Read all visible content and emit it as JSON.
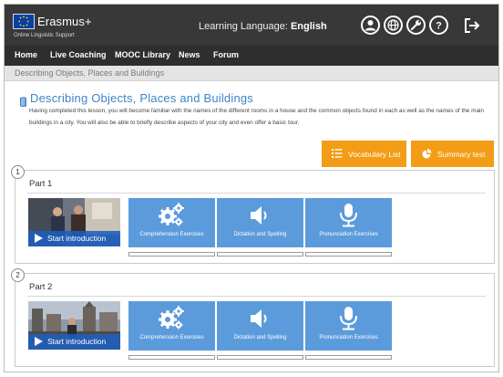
{
  "header": {
    "brand": "Erasmus+",
    "brand_sub": "Online Linguistic Support",
    "language_prefix": "Learning Language: ",
    "language": "English",
    "icons": [
      "user-icon",
      "globe-icon",
      "wrench-icon",
      "help-icon",
      "logout-icon"
    ]
  },
  "menu": {
    "items": [
      "Home",
      "Live Coaching",
      "MOOC Library",
      "News",
      "Forum"
    ]
  },
  "breadcrumb": "Describing Objects, Places and Buildings",
  "lesson": {
    "title": "Describing Objects, Places and Buildings",
    "description": "Having completed this lesson, you will become familiar with the names of the different rooms in a house and the common objects found in each as well as the names of the main buildings in a city. You will also be able to briefly describe aspects of your city and even offer a basic tour.",
    "vocabulary_label": "Vocabulary List",
    "summary_label": "Summary test"
  },
  "colors": {
    "header_bg": "#383838",
    "menu_bg": "#2e2e2e",
    "title_blue": "#3f84c6",
    "tile_blue": "#5b9bdc",
    "accent_orange": "#f39c16"
  },
  "parts": [
    {
      "number": "1",
      "title": "Part 1",
      "video_label": "Start introduction",
      "tiles": [
        {
          "label": "Comprehension Exercises",
          "icon": "gears-icon",
          "progress": 0
        },
        {
          "label": "Dictation and Spelling",
          "icon": "speaker-icon",
          "progress": 0
        },
        {
          "label": "Pronunciation Exercises",
          "icon": "microphone-icon",
          "progress": 0
        }
      ]
    },
    {
      "number": "2",
      "title": "Part 2",
      "video_label": "Start introduction",
      "tiles": [
        {
          "label": "Comprehension Exercises",
          "icon": "gears-icon",
          "progress": 0
        },
        {
          "label": "Dictation and Spelling",
          "icon": "speaker-icon",
          "progress": 0
        },
        {
          "label": "Pronunciation Exercises",
          "icon": "microphone-icon",
          "progress": 0
        }
      ]
    }
  ]
}
